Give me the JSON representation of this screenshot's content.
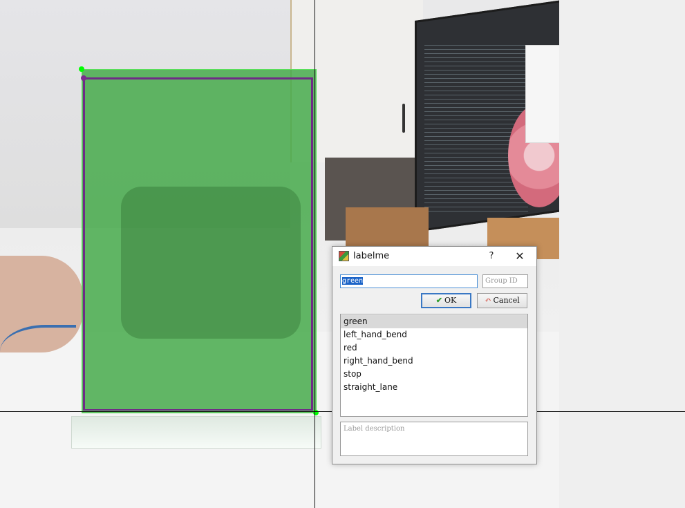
{
  "canvas": {
    "label": "annotation canvas"
  },
  "shape": {
    "label": "green",
    "fill_color": "#46aa4b",
    "outline_color": "#6f2b86",
    "vertex_color": "#00ff00"
  },
  "dialog": {
    "title": "labelme",
    "help_label": "?",
    "close_label": "✕",
    "label_input": {
      "value": "green",
      "placeholder": ""
    },
    "group_id": {
      "value": "",
      "placeholder": "Group ID"
    },
    "ok_button": {
      "label": "OK",
      "icon": "checkmark-icon"
    },
    "cancel_button": {
      "label": "Cancel",
      "icon": "undo-arrow-icon"
    },
    "labels": [
      {
        "name": "green",
        "selected": true
      },
      {
        "name": "left_hand_bend",
        "selected": false
      },
      {
        "name": "red",
        "selected": false
      },
      {
        "name": "right_hand_bend",
        "selected": false
      },
      {
        "name": "stop",
        "selected": false
      },
      {
        "name": "straight_lane",
        "selected": false
      }
    ],
    "description": {
      "placeholder": "Label description"
    }
  }
}
